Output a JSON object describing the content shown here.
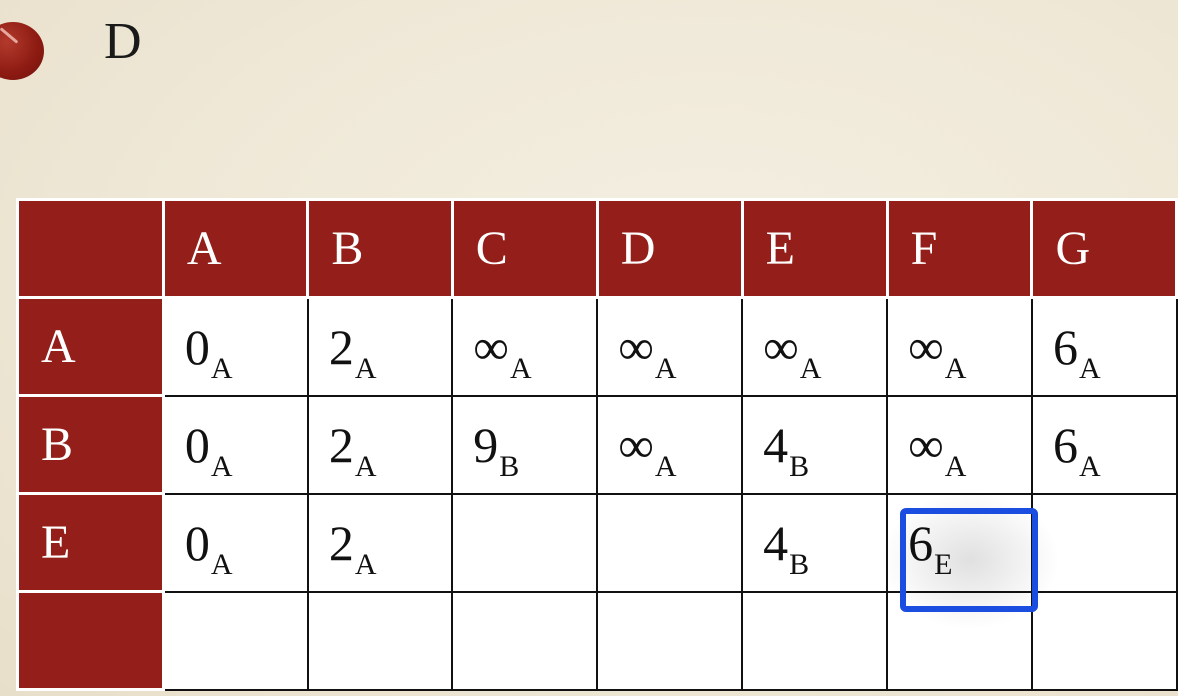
{
  "heading": {
    "bullet_text": "D"
  },
  "table": {
    "columns": [
      "A",
      "B",
      "C",
      "D",
      "E",
      "F",
      "G"
    ],
    "rows": [
      {
        "label": "A",
        "cells": [
          {
            "v": "0",
            "s": "A",
            "blue": true
          },
          {
            "v": "2",
            "s": "A",
            "blue": false
          },
          {
            "v": "∞",
            "s": "A",
            "blue": false
          },
          {
            "v": "∞",
            "s": "A",
            "blue": false
          },
          {
            "v": "∞",
            "s": "A",
            "blue": false
          },
          {
            "v": "∞",
            "s": "A",
            "blue": false
          },
          {
            "v": "6",
            "s": "A",
            "blue": false
          }
        ]
      },
      {
        "label": "B",
        "cells": [
          {
            "v": "0",
            "s": "A",
            "blue": true
          },
          {
            "v": "2",
            "s": "A",
            "blue": true
          },
          {
            "v": "9",
            "s": "B",
            "blue": false
          },
          {
            "v": "∞",
            "s": "A",
            "blue": false
          },
          {
            "v": "4",
            "s": "B",
            "blue": false
          },
          {
            "v": "∞",
            "s": "A",
            "blue": false
          },
          {
            "v": "6",
            "s": "A",
            "blue": false
          }
        ]
      },
      {
        "label": "E",
        "cells": [
          {
            "v": "0",
            "s": "A",
            "blue": true
          },
          {
            "v": "2",
            "s": "A",
            "blue": true
          },
          {
            "v": "",
            "s": "",
            "blue": false
          },
          {
            "v": "",
            "s": "",
            "blue": false
          },
          {
            "v": "4",
            "s": "B",
            "blue": true
          },
          {
            "v": "6",
            "s": "E",
            "blue": false
          },
          {
            "v": "",
            "s": "",
            "blue": false
          }
        ]
      },
      {
        "label": "",
        "cells": [
          {
            "v": "",
            "s": "",
            "blue": false
          },
          {
            "v": "",
            "s": "",
            "blue": false
          },
          {
            "v": "",
            "s": "",
            "blue": false
          },
          {
            "v": "",
            "s": "",
            "blue": false
          },
          {
            "v": "",
            "s": "",
            "blue": false
          },
          {
            "v": "",
            "s": "",
            "blue": false
          },
          {
            "v": "",
            "s": "",
            "blue": false
          }
        ]
      }
    ],
    "highlighted_cell": {
      "row": "E",
      "column": "F"
    },
    "colors": {
      "header": "#941f1a",
      "visited": "#2a55d3",
      "highlight": "#1a4de0"
    }
  }
}
